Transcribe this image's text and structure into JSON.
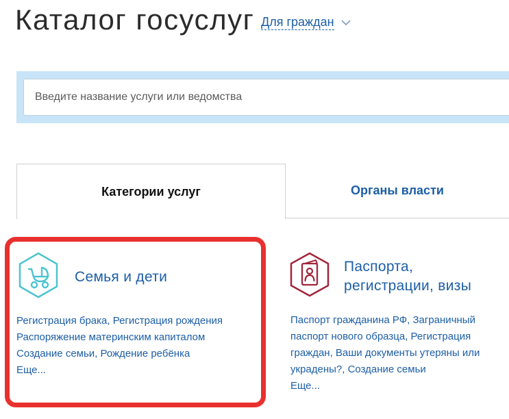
{
  "header": {
    "title": "Каталог госуслуг",
    "audience_label": "Для граждан"
  },
  "search": {
    "placeholder": "Введите название услуги или ведомства",
    "value": ""
  },
  "tabs": [
    {
      "label": "Категории услуг",
      "active": true
    },
    {
      "label": "Органы власти",
      "active": false
    }
  ],
  "categories": [
    {
      "icon": "baby-stroller-icon",
      "title": "Семья и дети",
      "links": [
        "Регистрация брака",
        "Регистрация рождения",
        "Распоряжение материнским капиталом",
        "Создание семьи",
        "Рождение ребёнка"
      ],
      "more": "Еще...",
      "highlighted": true
    },
    {
      "icon": "passport-icon",
      "title_lines": [
        "Паспорта,",
        "регистрации, визы"
      ],
      "links": [
        "Паспорт гражданина РФ",
        "Заграничный паспорт нового образца",
        "Регистрация граждан",
        "Ваши документы утеряны или украдены?",
        "Создание семьи"
      ],
      "more": "Еще..."
    }
  ],
  "colors": {
    "link": "#1c5ea6",
    "highlight_border": "#e8312e",
    "search_band": "#c8e4f7",
    "family_icon": "#4cc3cf",
    "passport_icon": "#a1243a"
  }
}
